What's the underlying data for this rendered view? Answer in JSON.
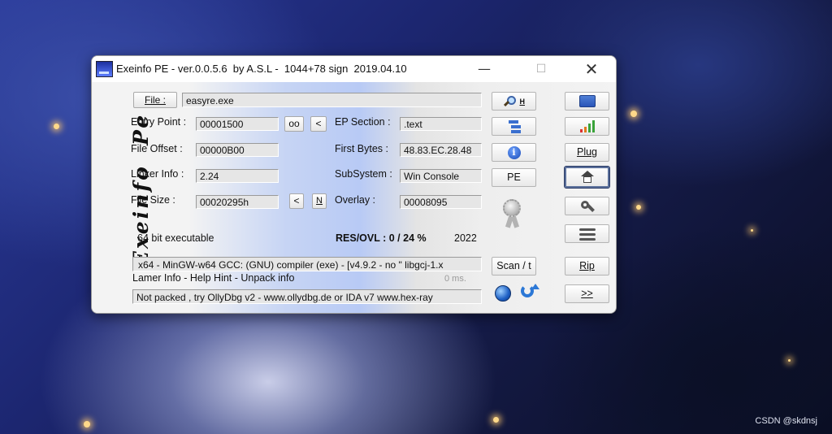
{
  "window": {
    "title": "Exeinfo PE - ver.0.0.5.6  by A.S.L -  1044+78 sign  2019.04.10",
    "min_glyph": "—",
    "max_glyph": "☐",
    "close_glyph": "✕"
  },
  "logo_text": "Exeinfo  Pe",
  "file": {
    "button_label": "File :",
    "path_value": "easyre.exe"
  },
  "fields": {
    "entry_point": {
      "label": "Entry Point :",
      "value": "00001500"
    },
    "ep_buttons": {
      "oo": "oo",
      "lt": "<"
    },
    "ep_section": {
      "label": "EP Section :",
      "value": ".text"
    },
    "file_offset": {
      "label": "File Offset :",
      "value": "00000B00"
    },
    "first_bytes": {
      "label": "First Bytes :",
      "value": "48.83.EC.28.48"
    },
    "linker_info": {
      "label": "Linker Info :",
      "value": "2.24"
    },
    "subsystem": {
      "label": "SubSystem :",
      "value": "Win Console"
    },
    "file_size": {
      "label": "File Size :",
      "value": "00020295h"
    },
    "fs_buttons": {
      "lt": "<",
      "n": "N"
    },
    "overlay": {
      "label": "Overlay :",
      "value": "00008095"
    }
  },
  "status": {
    "bitness": "64 bit executable",
    "res_ovl": "RES/OVL : 0 / 24 %",
    "year": "2022"
  },
  "detection": "x64 - MinGW-w64 GCC: (GNU) compiler (exe) - [v4.9.2 - no \" libgcj-1.x",
  "lamer_info": "Lamer Info - Help Hint - Unpack info",
  "timing": "0 ms.",
  "hint": "Not packed , try OllyDbg v2 - www.ollydbg.de or IDA v7 www.hex-ray",
  "mid_buttons": {
    "search_suffix": "H",
    "pe": "PE",
    "scan": "Scan / t"
  },
  "right_buttons": {
    "plug": "Plug",
    "rip": "Rip",
    "more": ">>"
  },
  "watermark": "CSDN @skdnsj"
}
